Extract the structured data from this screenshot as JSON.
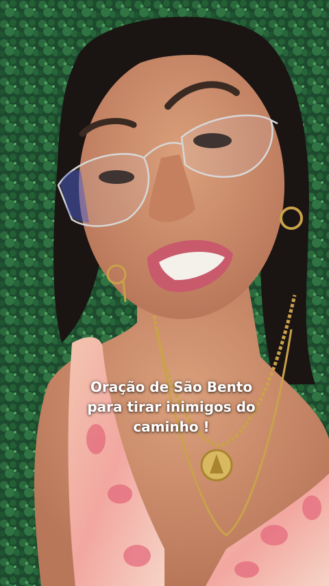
{
  "caption": {
    "lines": [
      "Oração de São Bento",
      "para tirar inimigos do",
      "caminho !"
    ]
  },
  "colors": {
    "background_hedge": "#1d4a2e",
    "hair": "#1a1412",
    "skin": "#c98a68",
    "lips": "#c85a6c",
    "dress": "#f0b0a0",
    "gold": "#c9a24a",
    "caption_text": "#ffffff"
  },
  "icons": {
    "medal": "sao-bento-medal-icon"
  }
}
